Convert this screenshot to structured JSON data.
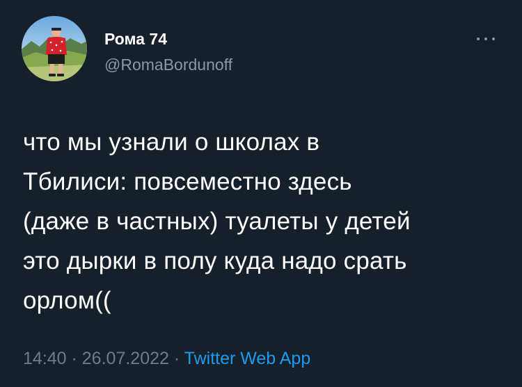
{
  "author": {
    "display_name": "Рома 74",
    "handle": "@RomaBordunoff"
  },
  "tweet": {
    "text": "что мы узнали о школах в\nТбилиси: повсеместно здесь\n(даже в частных) туалеты у детей\nэто дырки в полу куда надо срать\nорлом(("
  },
  "meta": {
    "time": "14:40",
    "separator_1": " · ",
    "date": "26.07.2022",
    "separator_2": " · ",
    "source": "Twitter Web App"
  },
  "icons": {
    "more": "more-horizontal-icon"
  },
  "colors": {
    "background": "#15202b",
    "primary_text": "#ffffff",
    "secondary_text": "#8b98a5",
    "accent": "#1d9bf0"
  }
}
